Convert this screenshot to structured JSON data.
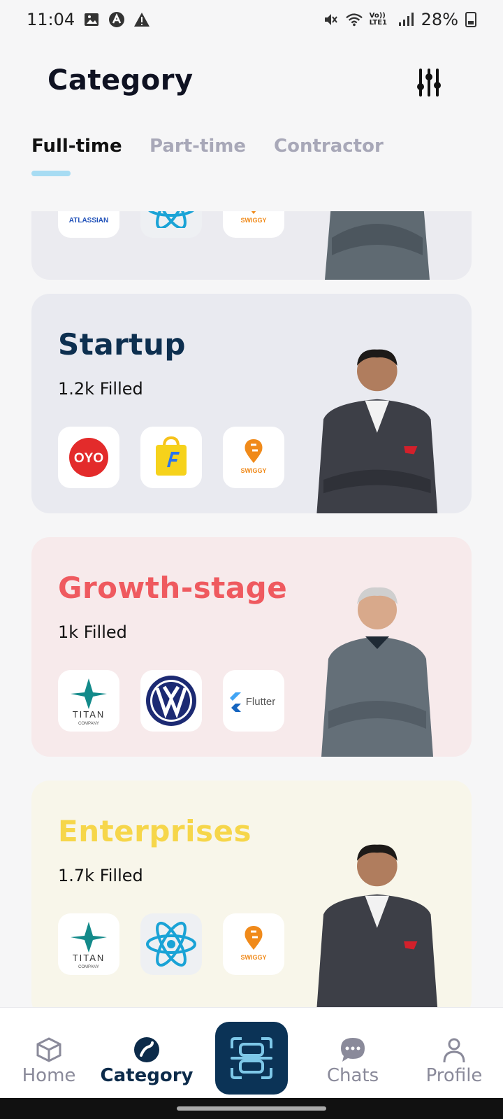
{
  "status_bar": {
    "time": "11:04",
    "battery": "28%",
    "network": "Vo)) LTE1"
  },
  "header": {
    "title": "Category"
  },
  "tabs": [
    {
      "label": "Full-time",
      "active": true
    },
    {
      "label": "Part-time",
      "active": false
    },
    {
      "label": "Contractor",
      "active": false
    }
  ],
  "cards": [
    {
      "title": "",
      "count": "",
      "bg": "#ebebf0",
      "logos": [
        "atlassian",
        "react",
        "swiggy"
      ],
      "logo_labels": [
        "ATLASSIAN",
        "",
        "SWIGGY"
      ]
    },
    {
      "title": "Startup",
      "count": "1.2k Filled",
      "bg": "#e9eaf0",
      "title_color": "#0d2f4f",
      "logos": [
        "oyo",
        "flipkart",
        "swiggy"
      ],
      "logo_labels": [
        "OYO",
        "",
        "SWIGGY"
      ]
    },
    {
      "title": "Growth-stage",
      "count": "1k Filled",
      "bg": "#f7eaeb",
      "title_color": "#ef5a5f",
      "logos": [
        "titan",
        "volkswagen",
        "flutter"
      ],
      "logo_labels": [
        "TITAN",
        "",
        "Flutter"
      ],
      "logo_sublabels": [
        "COMPANY",
        "",
        ""
      ]
    },
    {
      "title": "Enterprises",
      "count": "1.7k Filled",
      "bg": "#f8f6ea",
      "title_color": "#f6d64a",
      "logos": [
        "titan",
        "react",
        "swiggy"
      ],
      "logo_labels": [
        "TITAN",
        "",
        "SWIGGY"
      ],
      "logo_sublabels": [
        "COMPANY",
        "",
        ""
      ]
    }
  ],
  "bottom_nav": [
    {
      "label": "Home",
      "icon": "cube-icon",
      "active": false
    },
    {
      "label": "Category",
      "icon": "category-icon",
      "active": true
    },
    {
      "label": "",
      "icon": "scan-icon",
      "active": false
    },
    {
      "label": "Chats",
      "icon": "chat-icon",
      "active": false
    },
    {
      "label": "Profile",
      "icon": "profile-icon",
      "active": false
    }
  ]
}
